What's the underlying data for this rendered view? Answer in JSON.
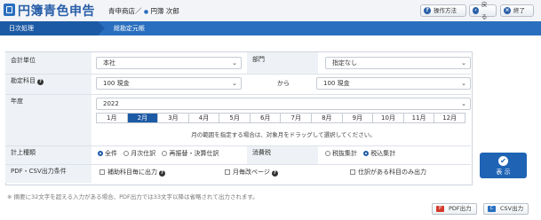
{
  "app": {
    "title": "円簿青色申告",
    "company": "青申商店",
    "separator": "／",
    "user": "円簿 次郎"
  },
  "toolbar": {
    "help": "操作方法",
    "back": "戻る",
    "exit": "終了"
  },
  "nav": {
    "step1": "日次処理",
    "step2": "総勘定元帳"
  },
  "form": {
    "unit_label": "会計単位",
    "unit_value": "本社",
    "dept_label": "部門",
    "dept_value": "指定なし",
    "account_label": "勘定科目",
    "account_from": "100 現金",
    "range_word": "から",
    "account_to": "100 現金",
    "year_label": "年度",
    "year_value": "2022",
    "months": [
      "1月",
      "2月",
      "3月",
      "4月",
      "5月",
      "6月",
      "7月",
      "8月",
      "9月",
      "10月",
      "11月",
      "12月"
    ],
    "selected_month": "2月",
    "range_hint": "月の範囲を指定する場合は、対象月をドラッグして選択してください。",
    "calc_label": "計上種類",
    "calc_options": [
      "全件",
      "月次仕訳",
      "再振替・決算仕訳"
    ],
    "tax_label": "消費税",
    "tax_options": [
      "税抜集計",
      "税込集計"
    ],
    "pdf_label": "PDF・CSV出力条件",
    "pdf_options": [
      "補助科目毎に出力",
      "月毎改ページ",
      "仕訳がある科目のみ出力"
    ]
  },
  "display_button": "表 示",
  "note": "※ 摘要に32文字を超える入力がある場合、PDF出力では33文字以降は省略されて出力されます。",
  "output": {
    "pdf": "PDF出力",
    "csv": "CSV出力"
  },
  "colors": {
    "primary": "#1d5aa5",
    "nav": "#2a6fbf",
    "label_bg": "#eef2f6"
  }
}
